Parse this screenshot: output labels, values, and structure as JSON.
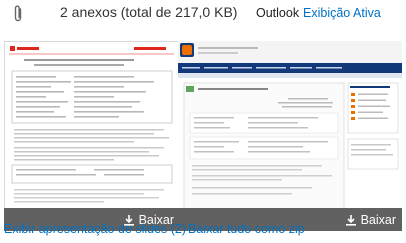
{
  "header": {
    "attachment_icon": "paperclip-icon",
    "summary": "2 anexos (total de 217,0 KB)",
    "brand": "Outlook",
    "view_link": "Exibição Ativa"
  },
  "attachments": [
    {
      "preview": "document-preview",
      "download_icon": "download-icon",
      "download_label": "Baixar"
    },
    {
      "preview": "webpage-preview",
      "download_icon": "download-icon",
      "download_label": "Baixar"
    }
  ],
  "footer": {
    "slideshow_link": "Exibir apresentação de slides (2)",
    "zip_link": "Baixar tudo como zip"
  },
  "colors": {
    "link": "#0072c6",
    "overlay": "#555555",
    "santander_red": "#e0261b",
    "itau_blue": "#123a7a",
    "itau_orange": "#ec7000"
  }
}
